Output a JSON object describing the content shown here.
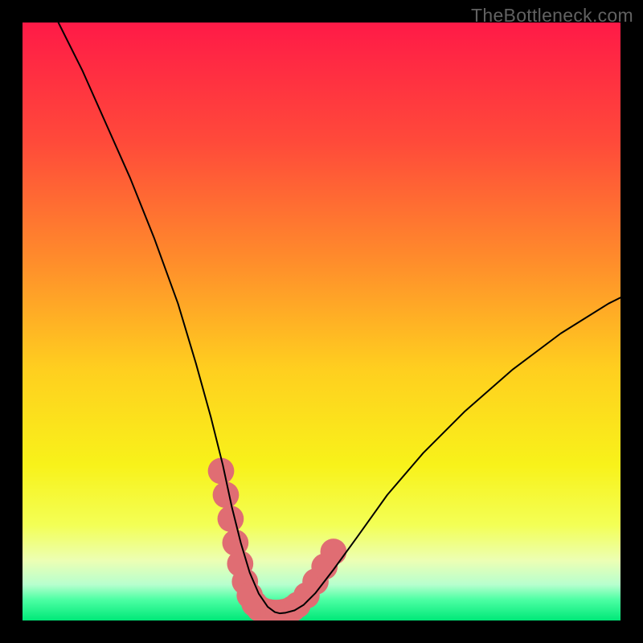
{
  "watermark": "TheBottleneck.com",
  "chart_data": {
    "type": "line",
    "title": "",
    "xlabel": "",
    "ylabel": "",
    "xlim": [
      0,
      100
    ],
    "ylim": [
      0,
      100
    ],
    "background_gradient": {
      "stops": [
        {
          "offset": 0.0,
          "color": "#ff1a47"
        },
        {
          "offset": 0.2,
          "color": "#ff4a3a"
        },
        {
          "offset": 0.4,
          "color": "#ff8d2b"
        },
        {
          "offset": 0.58,
          "color": "#ffcf1f"
        },
        {
          "offset": 0.74,
          "color": "#f8f21a"
        },
        {
          "offset": 0.84,
          "color": "#f3ff55"
        },
        {
          "offset": 0.9,
          "color": "#ecffb4"
        },
        {
          "offset": 0.94,
          "color": "#b7ffce"
        },
        {
          "offset": 0.965,
          "color": "#4dffa4"
        },
        {
          "offset": 1.0,
          "color": "#00e878"
        }
      ]
    },
    "series": [
      {
        "name": "bottleneck-curve",
        "x": [
          6,
          10,
          14,
          18,
          22,
          26,
          29,
          31.5,
          33.5,
          35,
          36.5,
          38,
          39.5,
          41,
          42.2,
          43,
          44,
          45.5,
          47,
          49,
          52,
          56,
          61,
          67,
          74,
          82,
          90,
          98,
          100
        ],
        "y": [
          100,
          92,
          83,
          74,
          64,
          53,
          43,
          34,
          26,
          19,
          13,
          8,
          4.5,
          2.3,
          1.4,
          1.2,
          1.3,
          1.7,
          2.6,
          4.6,
          8.5,
          14,
          21,
          28,
          35,
          42,
          48,
          53,
          54
        ],
        "stroke": "#000000",
        "stroke_width": 2
      }
    ],
    "markers": {
      "name": "highlight-dots",
      "color": "#e06d73",
      "points": [
        {
          "x": 33.2,
          "y": 25
        },
        {
          "x": 34.0,
          "y": 21
        },
        {
          "x": 34.8,
          "y": 17
        },
        {
          "x": 35.6,
          "y": 13
        },
        {
          "x": 36.4,
          "y": 9.5
        },
        {
          "x": 37.2,
          "y": 6.5
        },
        {
          "x": 38.0,
          "y": 4.2
        },
        {
          "x": 38.8,
          "y": 2.8
        },
        {
          "x": 39.6,
          "y": 2.0
        },
        {
          "x": 40.4,
          "y": 1.6
        },
        {
          "x": 41.2,
          "y": 1.4
        },
        {
          "x": 42.0,
          "y": 1.3
        },
        {
          "x": 42.8,
          "y": 1.3
        },
        {
          "x": 43.6,
          "y": 1.4
        },
        {
          "x": 44.4,
          "y": 1.6
        },
        {
          "x": 45.2,
          "y": 2.0
        },
        {
          "x": 46.0,
          "y": 2.6
        },
        {
          "x": 47.5,
          "y": 4.2
        },
        {
          "x": 49.0,
          "y": 6.5
        },
        {
          "x": 50.5,
          "y": 9.0
        },
        {
          "x": 52.0,
          "y": 11.5
        }
      ],
      "radius": 2.2
    }
  }
}
